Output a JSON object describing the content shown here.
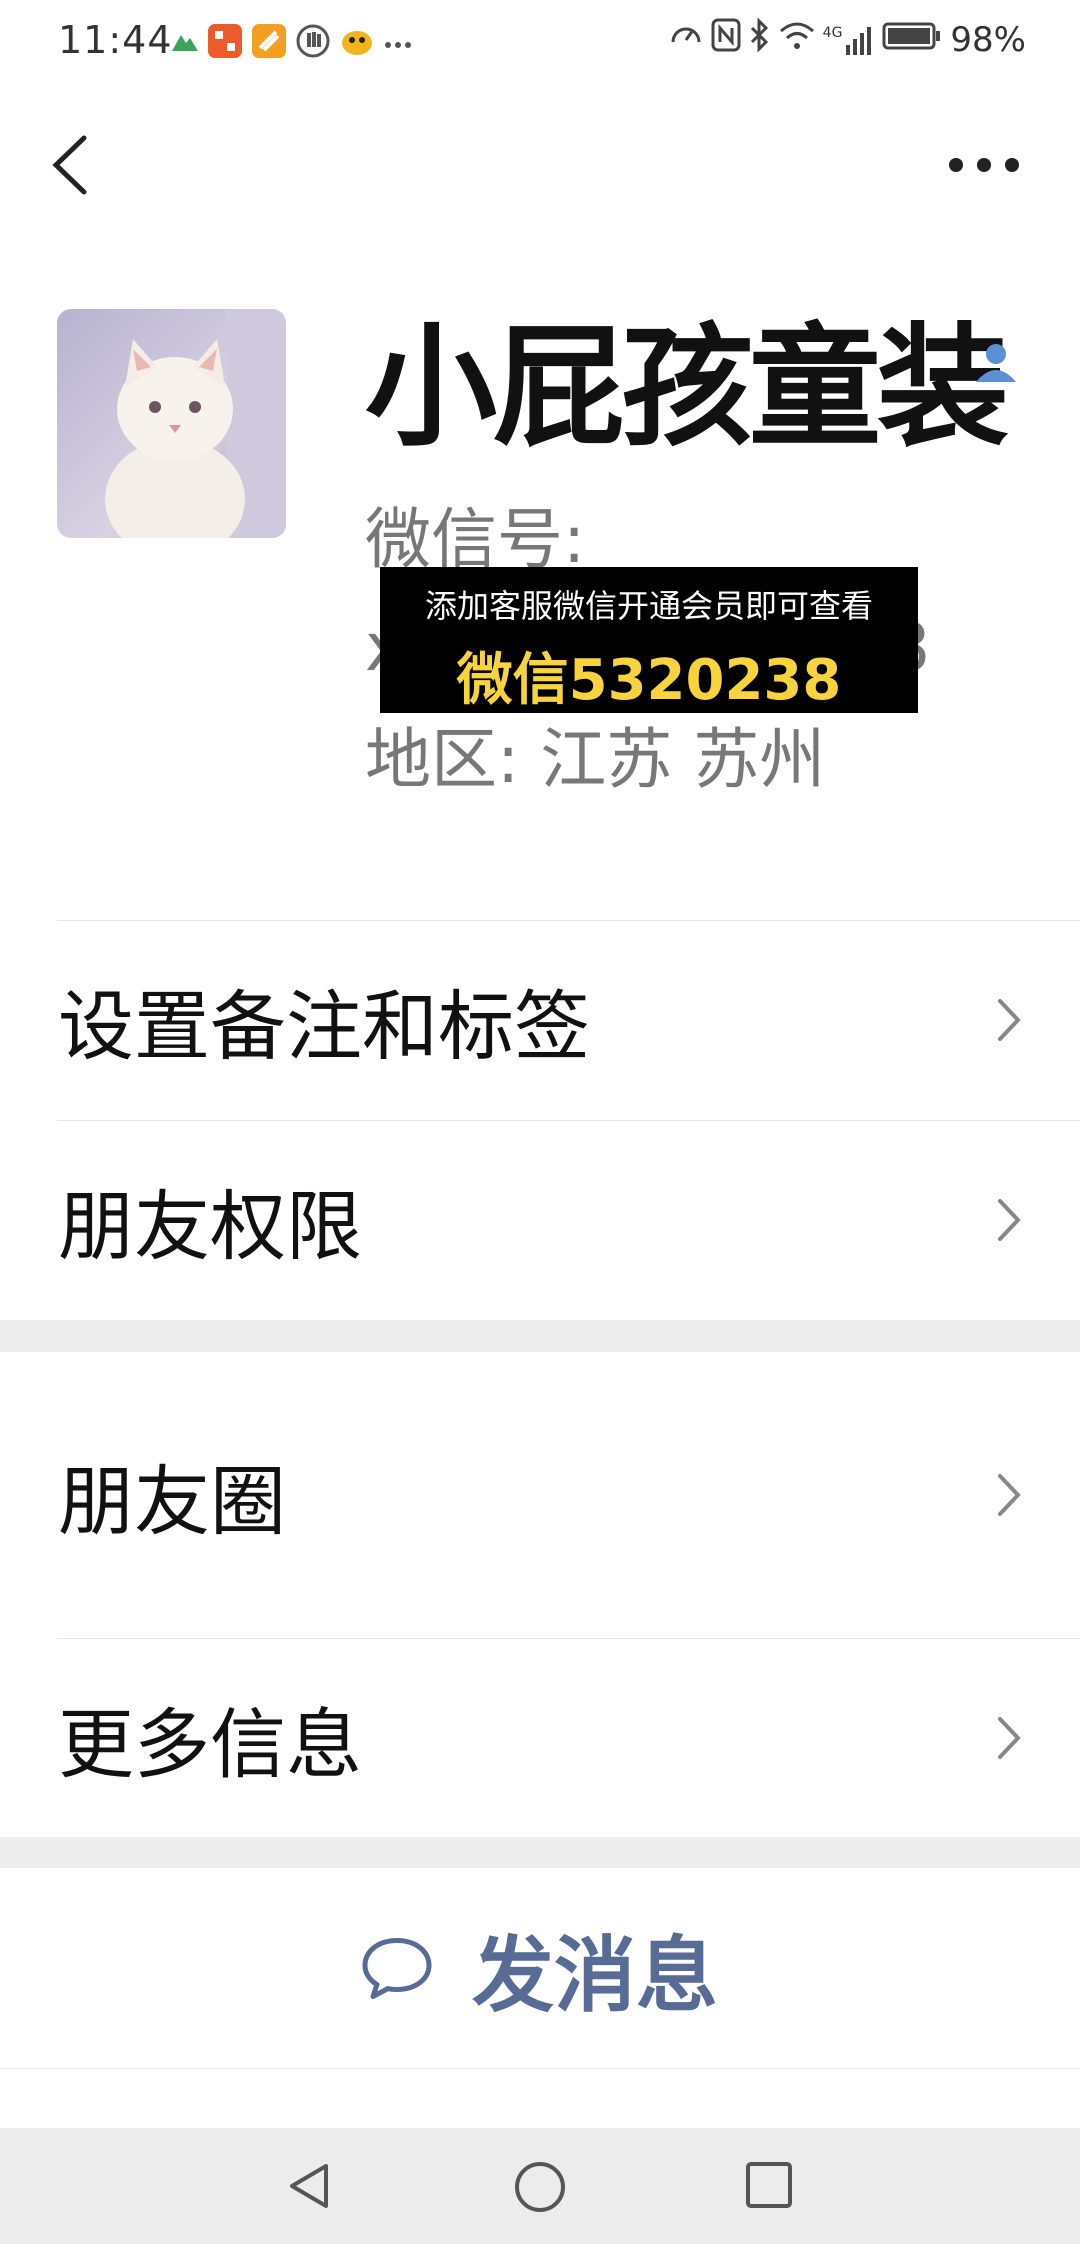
{
  "status_bar": {
    "time": "11:44",
    "battery": "98%",
    "network": "4G",
    "icons": [
      "mountain-icon",
      "app-icon",
      "app-icon",
      "hand-icon",
      "bird-icon",
      "more-dots-icon",
      "speedometer-icon",
      "nfc-icon",
      "bluetooth-icon",
      "wifi-icon",
      "signal-icon",
      "battery-icon"
    ]
  },
  "nav": {
    "back_icon": "chevron-left-icon",
    "more_icon": "more-dots-icon"
  },
  "profile": {
    "name": "小屁孩童装",
    "wechat_id_label": "微信号:",
    "wechat_id_prefix": "x",
    "wechat_id_suffix": "8",
    "region": "地区:  江苏  苏州",
    "profile_icon": "person-icon"
  },
  "overlay": {
    "line1": "添加客服微信开通会员即可查看",
    "line2": "微信5320238",
    "line2_color": "#f7d43e"
  },
  "menu": {
    "items": [
      {
        "label": "设置备注和标签"
      },
      {
        "label": "朋友权限"
      },
      {
        "label": "朋友圈"
      },
      {
        "label": "更多信息"
      }
    ]
  },
  "actions": {
    "send_message": "发消息",
    "send_icon": "chat-bubble-icon",
    "accent_color": "#576b95"
  },
  "system_nav": [
    "back-triangle-icon",
    "home-circle-icon",
    "recents-square-icon"
  ]
}
